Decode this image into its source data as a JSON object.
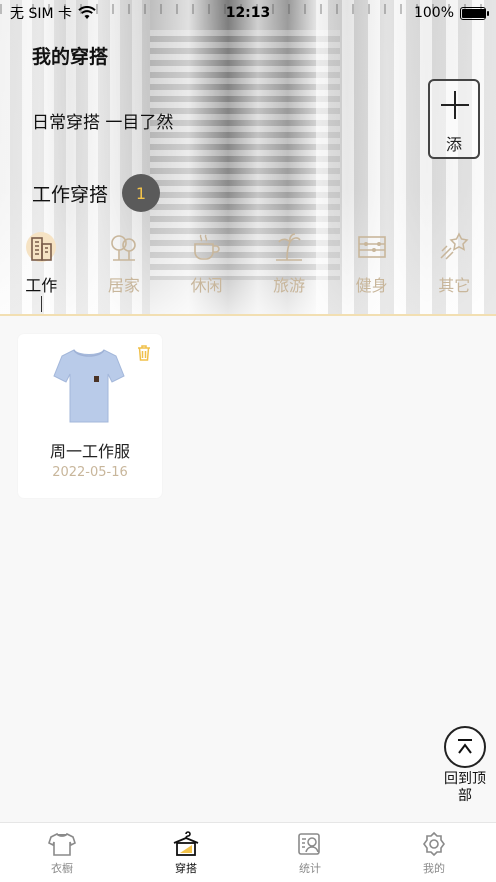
{
  "status_bar": {
    "carrier": "无 SIM 卡",
    "time": "12:13",
    "battery": "100%"
  },
  "header": {
    "title": "我的穿搭",
    "subtitle": "日常穿搭   一目了然",
    "section_label": "工作穿搭",
    "section_count": "1",
    "add_label": "添"
  },
  "categories": [
    {
      "label": "工作",
      "icon": "building-icon",
      "active": true
    },
    {
      "label": "居家",
      "icon": "tree-icon",
      "active": false
    },
    {
      "label": "休闲",
      "icon": "teacup-icon",
      "active": false
    },
    {
      "label": "旅游",
      "icon": "palm-tree-icon",
      "active": false
    },
    {
      "label": "健身",
      "icon": "abacus-icon",
      "active": false
    },
    {
      "label": "其它",
      "icon": "shooting-star-icon",
      "active": false
    }
  ],
  "outfits": [
    {
      "name": "周一工作服",
      "date": "2022-05-16",
      "image": "tshirt-icon"
    }
  ],
  "back_to_top_label": "回到顶部",
  "tabbar": [
    {
      "label": "衣橱",
      "icon": "tshirt-icon",
      "active": false
    },
    {
      "label": "穿搭",
      "icon": "hanger-icon",
      "active": true
    },
    {
      "label": "统计",
      "icon": "stats-icon",
      "active": false
    },
    {
      "label": "我的",
      "icon": "gear-icon",
      "active": false
    }
  ],
  "colors": {
    "accent_gold": "#c8b69b",
    "badge_text": "#f3c34a",
    "divider": "#f2dfb2"
  }
}
